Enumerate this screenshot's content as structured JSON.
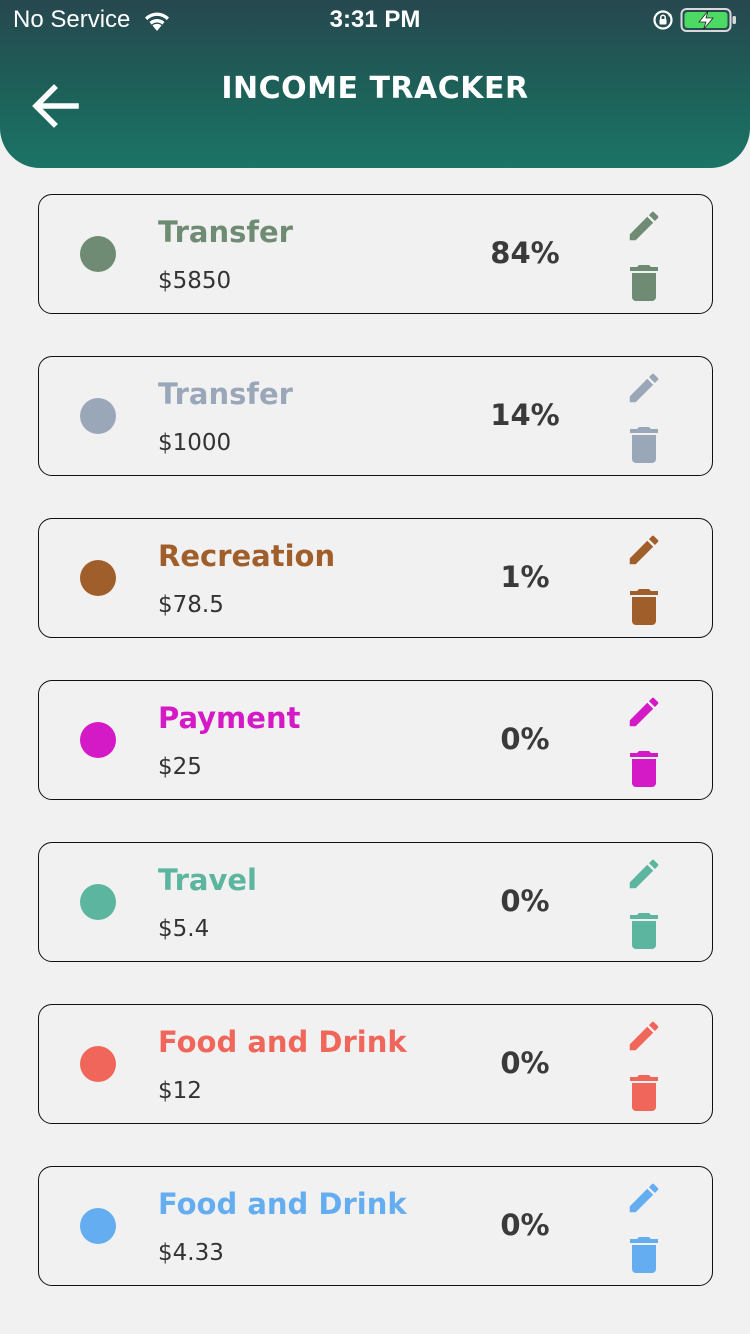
{
  "status_bar": {
    "carrier": "No Service",
    "time": "3:31 PM"
  },
  "header": {
    "title": "INCOME TRACKER"
  },
  "items": [
    {
      "name": "Transfer",
      "amount": "$5850",
      "percent": "84%",
      "color": "#6f8b73"
    },
    {
      "name": "Transfer",
      "amount": "$1000",
      "percent": "14%",
      "color": "#9aa7b9"
    },
    {
      "name": "Recreation",
      "amount": "$78.5",
      "percent": "1%",
      "color": "#a05e2b"
    },
    {
      "name": "Payment",
      "amount": "$25",
      "percent": "0%",
      "color": "#d419c6"
    },
    {
      "name": "Travel",
      "amount": "$5.4",
      "percent": "0%",
      "color": "#5bb59f"
    },
    {
      "name": "Food and Drink",
      "amount": "$12",
      "percent": "0%",
      "color": "#f0665a"
    },
    {
      "name": "Food and Drink",
      "amount": "$4.33",
      "percent": "0%",
      "color": "#64adf1"
    }
  ]
}
